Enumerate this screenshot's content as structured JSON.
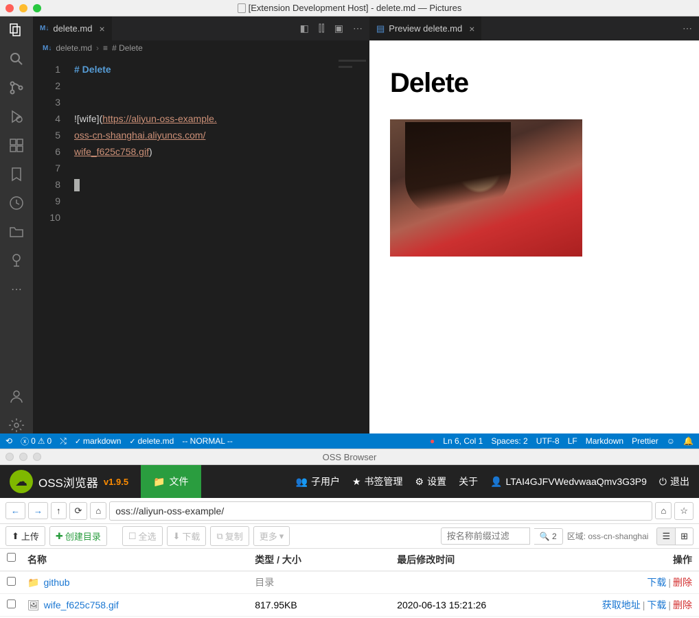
{
  "mac": {
    "title": "[Extension Development Host] - delete.md — Pictures"
  },
  "vscode": {
    "tab_left": {
      "name": "delete.md"
    },
    "tab_right": {
      "name": "Preview delete.md"
    },
    "breadcrumb": {
      "file": "delete.md",
      "symbol": "# Delete"
    },
    "code": {
      "l1": "# Delete",
      "l4a": "!",
      "l4b": "[wife]",
      "l4c": "(",
      "l4d": "https://aliyun-oss-example.",
      "l5": "oss-cn-shanghai.aliyuncs.com/",
      "l6a": "wife_f625c758.gif",
      "l6b": ")"
    },
    "lines": {
      "1": "1",
      "2": "2",
      "3": "3",
      "4": "4",
      "5": "5",
      "6": "6",
      "7": "7",
      "8": "8",
      "9": "9",
      "10": "10"
    },
    "status": {
      "errors": "0",
      "warnings": "0",
      "branch_md": "markdown",
      "branch_file": "delete.md",
      "vim": "-- NORMAL --",
      "pos": "Ln 6, Col 1",
      "spaces": "Spaces: 2",
      "enc": "UTF-8",
      "eol": "LF",
      "lang": "Markdown",
      "fmt": "Prettier"
    },
    "preview_heading": "Delete"
  },
  "oss": {
    "title": "OSS Browser",
    "brand": "OSS浏览器",
    "version": "v1.9.5",
    "nav_file": "文件",
    "nav_sub": "子用户",
    "nav_book": "书签管理",
    "nav_set": "设置",
    "nav_about": "关于",
    "nav_user": "LTAI4GJFVWedvwaaQmv3G3P9",
    "nav_exit": "退出",
    "addr": "oss://aliyun-oss-example/",
    "tb": {
      "upload": "上传",
      "mkdir": "创建目录",
      "selall": "全选",
      "download": "下载",
      "copy": "复制",
      "more": "更多",
      "search_ph": "按名称前缀过滤",
      "search_count": "2",
      "region": "区域: oss-cn-shanghai"
    },
    "head": {
      "name": "名称",
      "type": "类型 / 大小",
      "date": "最后修改时间",
      "act": "操作"
    },
    "rows": [
      {
        "name": "github",
        "type": "目录",
        "date": "",
        "act1": "下载",
        "act2": "删除"
      },
      {
        "name": "wife_f625c758.gif",
        "type": "817.95KB",
        "date": "2020-06-13 15:21:26",
        "act0": "获取地址",
        "act1": "下载",
        "act2": "删除"
      }
    ]
  }
}
